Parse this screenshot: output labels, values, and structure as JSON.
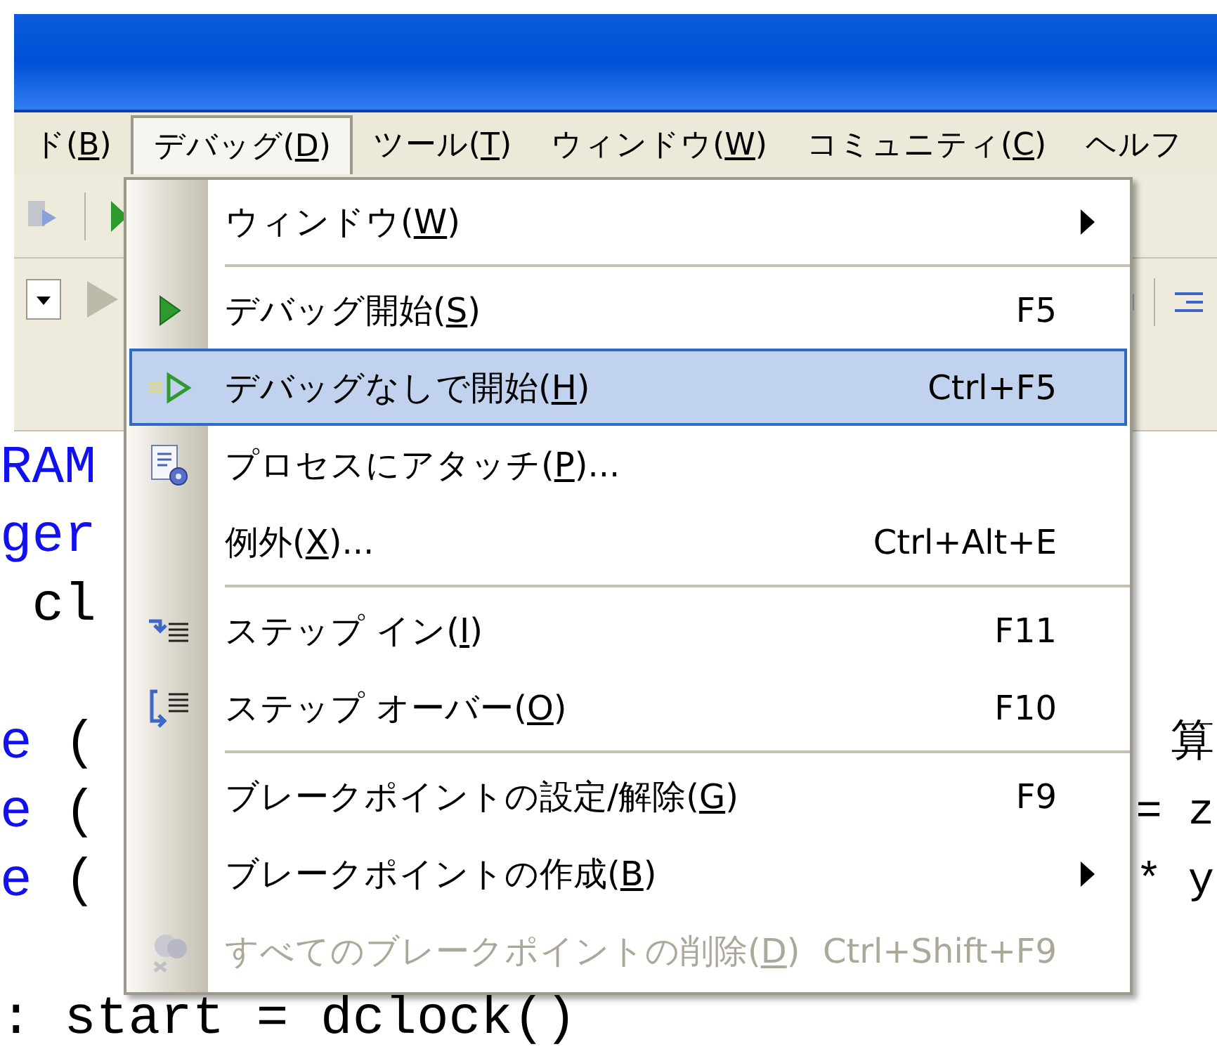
{
  "menubar": [
    {
      "before": "ド(",
      "mnemonic": "B",
      "after": ")",
      "selected": false
    },
    {
      "before": "デバッグ(",
      "mnemonic": "D",
      "after": ")",
      "selected": true
    },
    {
      "before": "ツール(",
      "mnemonic": "T",
      "after": ")",
      "selected": false
    },
    {
      "before": "ウィンドウ(",
      "mnemonic": "W",
      "after": ")",
      "selected": false
    },
    {
      "before": "コミュニティ(",
      "mnemonic": "C",
      "after": ")",
      "selected": false
    },
    {
      "before": "ヘルフ",
      "selected": false
    }
  ],
  "code_lines": [
    {
      "kind": "code",
      "left": [
        {
          "text": "RAM",
          "kind": "keyword"
        }
      ]
    },
    {
      "kind": "code",
      "left": [
        {
          "text": "ger",
          "kind": "keyword"
        }
      ]
    },
    {
      "kind": "code",
      "left": [
        {
          "text": " cl",
          "kind": "plain"
        }
      ]
    },
    {
      "kind": "blank"
    },
    {
      "kind": "code",
      "left": [
        {
          "text": "e",
          "kind": "keyword"
        },
        {
          "text": " (",
          "kind": "plain"
        }
      ],
      "right": [
        {
          "text": "算",
          "kind": "plain"
        }
      ]
    },
    {
      "kind": "code",
      "left": [
        {
          "text": "e",
          "kind": "keyword"
        },
        {
          "text": " (",
          "kind": "plain"
        }
      ],
      "right": [
        {
          "text": "= z",
          "kind": "plain"
        }
      ]
    },
    {
      "kind": "code",
      "left": [
        {
          "text": "e",
          "kind": "keyword"
        },
        {
          "text": " (",
          "kind": "plain"
        }
      ],
      "right": [
        {
          "text": "* y",
          "kind": "plain"
        }
      ]
    },
    {
      "kind": "blank"
    },
    {
      "kind": "code",
      "left": [
        {
          "text": ": start = dclock()",
          "kind": "plain"
        }
      ]
    }
  ],
  "menu": [
    {
      "kind": "plain",
      "before": "ウィンドウ(",
      "mnemonic": "W",
      "after": ")",
      "submenu": true,
      "selected": false,
      "disabled": false
    },
    {
      "kind": "separator"
    },
    {
      "kind": "play",
      "before": "デバッグ開始(",
      "mnemonic": "S",
      "after": ")",
      "shortcut": "F5",
      "submenu": false,
      "selected": false,
      "disabled": false
    },
    {
      "kind": "play-outline",
      "before": "デバッグなしで開始(",
      "mnemonic": "H",
      "after": ")",
      "shortcut": "Ctrl+F5",
      "submenu": false,
      "selected": true,
      "disabled": false
    },
    {
      "kind": "attach",
      "before": "プロセスにアタッチ(",
      "mnemonic": "P",
      "after": ")...",
      "submenu": false,
      "selected": false,
      "disabled": false
    },
    {
      "kind": "plain",
      "before": "例外(",
      "mnemonic": "X",
      "after": ")...",
      "shortcut": "Ctrl+Alt+E",
      "submenu": false,
      "selected": false,
      "disabled": false
    },
    {
      "kind": "separator"
    },
    {
      "kind": "step-in",
      "before": "ステップ イン(",
      "mnemonic": "I",
      "after": ")",
      "shortcut": "F11",
      "submenu": false,
      "selected": false,
      "disabled": false
    },
    {
      "kind": "step-over",
      "before": "ステップ オーバー(",
      "mnemonic": "O",
      "after": ")",
      "shortcut": "F10",
      "submenu": false,
      "selected": false,
      "disabled": false
    },
    {
      "kind": "separator"
    },
    {
      "kind": "plain",
      "before": "ブレークポイントの設定/解除(",
      "mnemonic": "G",
      "after": ")",
      "shortcut": "F9",
      "submenu": false,
      "selected": false,
      "disabled": false
    },
    {
      "kind": "plain",
      "before": "ブレークポイントの作成(",
      "mnemonic": "B",
      "after": ")",
      "submenu": true,
      "selected": false,
      "disabled": false
    },
    {
      "kind": "delete",
      "before": "すべてのブレークポイントの削除(",
      "mnemonic": "D",
      "after": ")",
      "shortcut": "Ctrl+Shift+F9",
      "submenu": false,
      "selected": false,
      "disabled": true
    }
  ]
}
